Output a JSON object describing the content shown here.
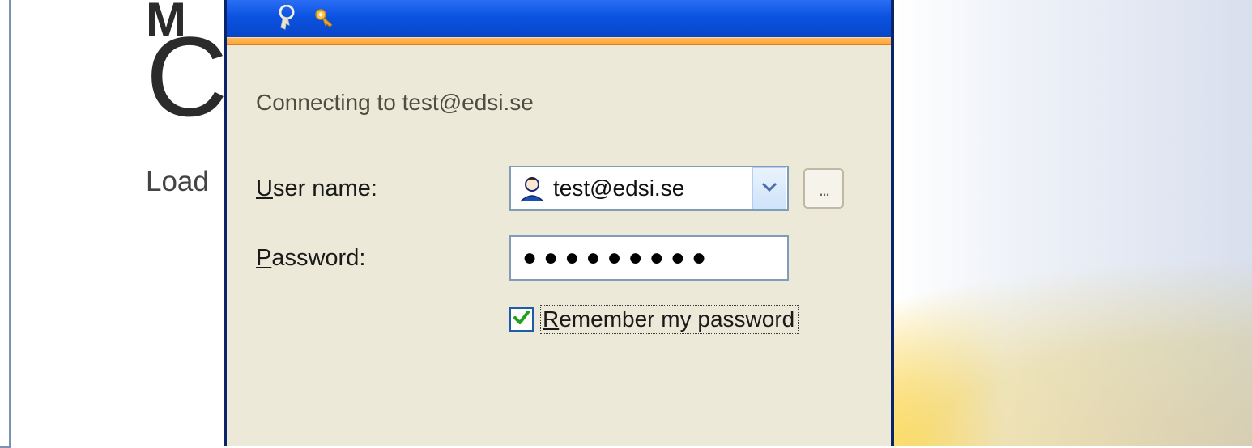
{
  "background": {
    "partial_m": "M",
    "partial_c": "C",
    "loading_partial": "Load"
  },
  "dialog": {
    "connecting_prefix": "Connecting to ",
    "connecting_target": "test@edsi.se",
    "username_label": "User name:",
    "username_accesskey": "U",
    "username_value": "test@edsi.se",
    "password_label": "Password:",
    "password_accesskey": "P",
    "password_masked": "●●●●●●●●●",
    "remember_label": "Remember my password",
    "remember_accesskey": "R",
    "remember_checked": true,
    "browse_button_label": "..."
  }
}
